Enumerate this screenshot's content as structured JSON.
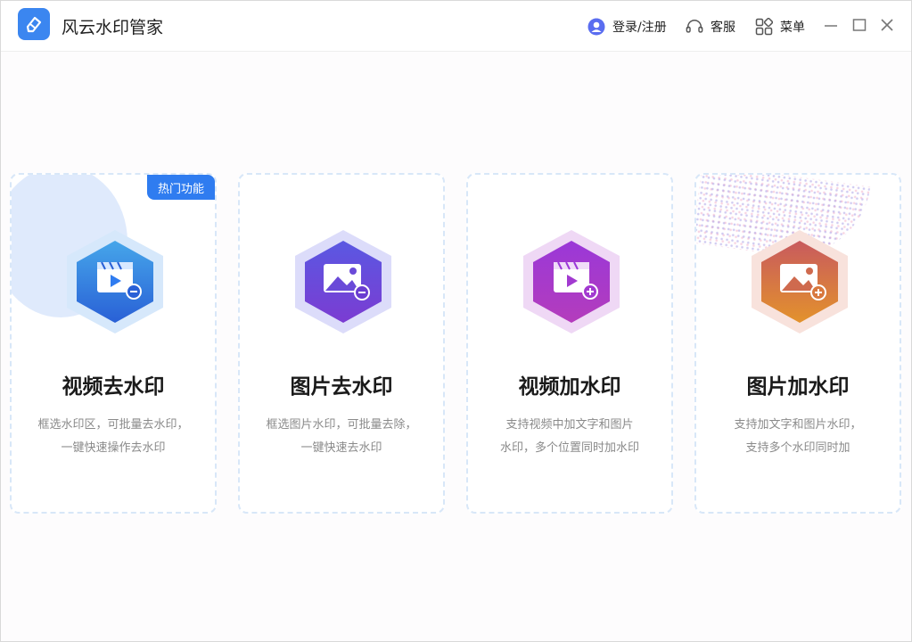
{
  "app": {
    "title": "风云水印管家"
  },
  "header": {
    "login_label": "登录/注册",
    "service_label": "客服",
    "menu_label": "菜单"
  },
  "cards": [
    {
      "title": "视频去水印",
      "desc1": "框选水印区，可批量去水印，",
      "desc2": "一键快速操作去水印",
      "badge": "热门功能",
      "icon": "video-remove-icon",
      "color1": "#3d9be8",
      "color2": "#2a5fd6"
    },
    {
      "title": "图片去水印",
      "desc1": "框选图片水印，可批量去除，",
      "desc2": "一键快速去水印",
      "icon": "image-remove-icon",
      "color1": "#5a55e0",
      "color2": "#7a3fd0"
    },
    {
      "title": "视频加水印",
      "desc1": "支持视频中加文字和图片",
      "desc2": "水印，多个位置同时加水印",
      "icon": "video-add-icon",
      "color1": "#9b3ad6",
      "color2": "#b13ac0"
    },
    {
      "title": "图片加水印",
      "desc1": "支持加文字和图片水印，",
      "desc2": "支持多个水印同时加",
      "icon": "image-add-icon",
      "color1": "#cf5a5a",
      "color2": "#e0902e"
    }
  ]
}
